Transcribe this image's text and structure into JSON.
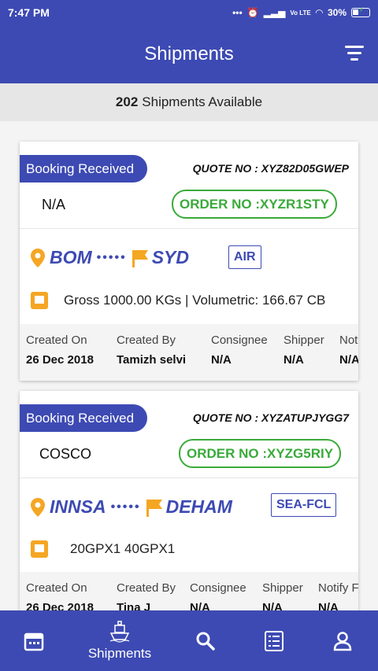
{
  "status_bar": {
    "time": "7:47 PM",
    "signal_text": "Vo LTE",
    "battery": "30%"
  },
  "header": {
    "title": "Shipments"
  },
  "summary": {
    "count": "202",
    "label": "Shipments Available"
  },
  "shipments": [
    {
      "status": "Booking Received",
      "quote": "QUOTE NO : XYZ82D05GWEP",
      "carrier": "N/A",
      "order": "ORDER NO :XYZR1STY",
      "origin": "BOM",
      "destination": "SYD",
      "mode": "AIR",
      "load": "Gross  1000.00 KGs | Volumetric: 166.67 CB",
      "meta_headers": [
        "Created On",
        "Created By",
        "Consignee",
        "Shipper",
        "Not"
      ],
      "meta_values": [
        "26 Dec 2018",
        "Tamizh  selvi",
        "N/A",
        "N/A",
        "N/A"
      ]
    },
    {
      "status": "Booking Received",
      "quote": "QUOTE NO : XYZATUPJYGG7",
      "carrier": "COSCO",
      "order": "ORDER NO :XYZG5RIY",
      "origin": "INNSA",
      "destination": "DEHAM",
      "mode": "SEA-FCL",
      "load": "20GPX1  40GPX1",
      "meta_headers": [
        "Created On",
        "Created By",
        "Consignee",
        "Shipper",
        "Notify F"
      ],
      "meta_values": [
        "26 Dec 2018",
        "Tina  J",
        "N/A",
        "N/A",
        "N/A"
      ]
    }
  ],
  "bottom_nav": {
    "items": [
      {
        "icon": "calendar-icon",
        "label": ""
      },
      {
        "icon": "ship-icon",
        "label": "Shipments"
      },
      {
        "icon": "search-icon",
        "label": ""
      },
      {
        "icon": "list-icon",
        "label": ""
      },
      {
        "icon": "user-icon",
        "label": ""
      }
    ]
  },
  "colors": {
    "primary": "#3d4ab3",
    "accent": "#f5a623",
    "order_green": "#3aaa3a"
  }
}
